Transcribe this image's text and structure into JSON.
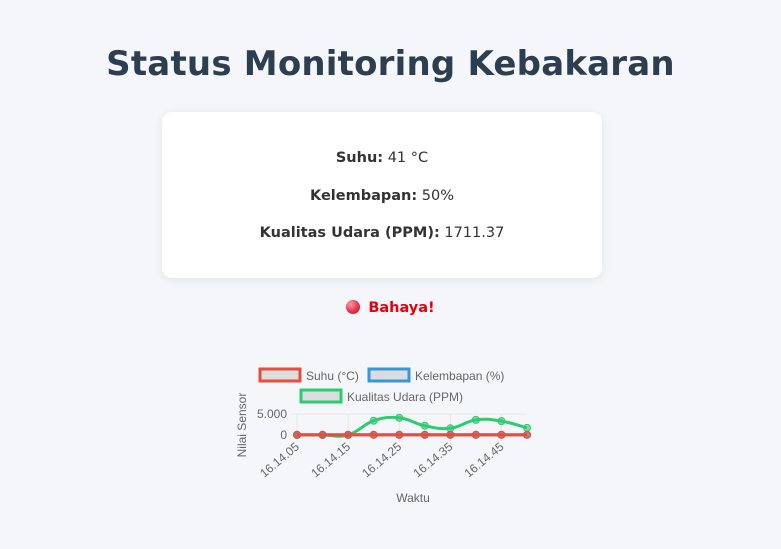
{
  "header": {
    "title": "Status Monitoring Kebakaran"
  },
  "readings": [
    {
      "label": "Suhu:",
      "value": "41 °C"
    },
    {
      "label": "Kelembapan:",
      "value": "50%"
    },
    {
      "label": "Kualitas Udara (PPM):",
      "value": "1711.37"
    }
  ],
  "status": {
    "text": "Bahaya!",
    "color": "#e3000f"
  },
  "chart_data": {
    "type": "line",
    "x": [
      "16.14.05",
      "16.14.10",
      "16.14.15",
      "16.14.20",
      "16.14.25",
      "16.14.30",
      "16.14.35",
      "16.14.40",
      "16.14.45",
      "16.14.50"
    ],
    "xticks": [
      "16.14.05",
      "16.14.15",
      "16.14.25",
      "16.14.35",
      "16.14.45"
    ],
    "yticks": [
      "5.000",
      "0"
    ],
    "xlabel": "Waktu",
    "ylabel": "Nilai Sensor",
    "ylim": [
      0,
      5000
    ],
    "legend_position": "top",
    "series": [
      {
        "name": "Suhu (°C)",
        "color": "#e74c3c",
        "values": [
          41,
          41,
          41,
          41,
          41,
          41,
          41,
          41,
          41,
          41
        ]
      },
      {
        "name": "Kelembapan (%)",
        "color": "#3498db",
        "values": [
          50,
          50,
          50,
          50,
          50,
          50,
          50,
          50,
          50,
          50
        ]
      },
      {
        "name": "Kualitas Udara (PPM)",
        "color": "#2ecc71",
        "values": [
          0,
          0,
          0,
          3400,
          4100,
          2200,
          1600,
          3600,
          3300,
          1700
        ]
      }
    ]
  }
}
